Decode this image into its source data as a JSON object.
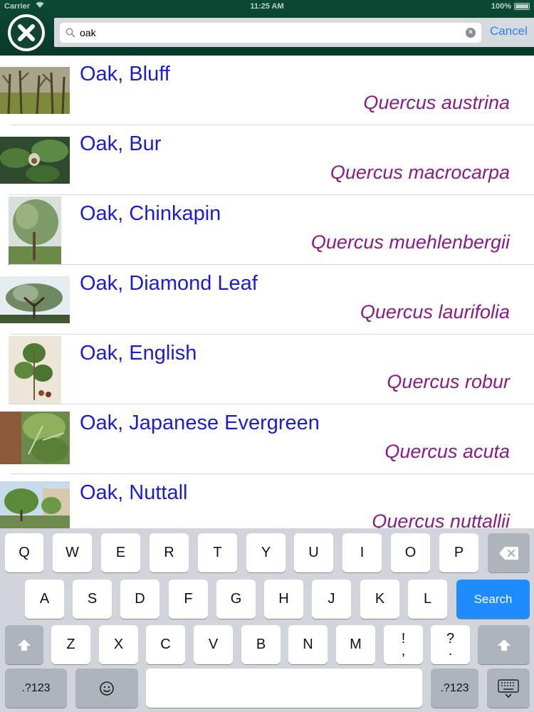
{
  "status_bar": {
    "carrier": "Carrier",
    "time": "11:25 AM",
    "battery": "100%"
  },
  "header": {
    "close_icon": "close-x-icon",
    "search": {
      "value": "oak",
      "placeholder": "",
      "cancel_label": "Cancel"
    }
  },
  "results": [
    {
      "common": "Oak, Bluff",
      "scientific": "Quercus austrina"
    },
    {
      "common": "Oak, Bur",
      "scientific": "Quercus macrocarpa"
    },
    {
      "common": "Oak, Chinkapin",
      "scientific": "Quercus muehlenbergii"
    },
    {
      "common": "Oak, Diamond Leaf",
      "scientific": "Quercus laurifolia"
    },
    {
      "common": "Oak, English",
      "scientific": "Quercus robur"
    },
    {
      "common": "Oak, Japanese Evergreen",
      "scientific": "Quercus acuta"
    },
    {
      "common": "Oak, Nuttall",
      "scientific": "Quercus nuttallii"
    }
  ],
  "keyboard": {
    "row1": [
      "Q",
      "W",
      "E",
      "R",
      "T",
      "Y",
      "U",
      "I",
      "O",
      "P"
    ],
    "row2": [
      "A",
      "S",
      "D",
      "F",
      "G",
      "H",
      "J",
      "K",
      "L"
    ],
    "row3": [
      "Z",
      "X",
      "C",
      "V",
      "B",
      "N",
      "M"
    ],
    "exclaim_top": "!",
    "exclaim_bottom": ",",
    "question_top": "?",
    "question_bottom": ".",
    "search_label": "Search",
    "numbers_label": ".?123",
    "emoji_icon": "emoji-icon",
    "backspace_icon": "backspace-icon",
    "shift_icon": "shift-icon",
    "dismiss_icon": "keyboard-dismiss-icon"
  },
  "colors": {
    "header_green": "#0c4a35",
    "common_name": "#1c1cd4",
    "scientific_name": "#8b1a8b",
    "cancel": "#2d7ff9",
    "search_key": "#1e8cff"
  }
}
